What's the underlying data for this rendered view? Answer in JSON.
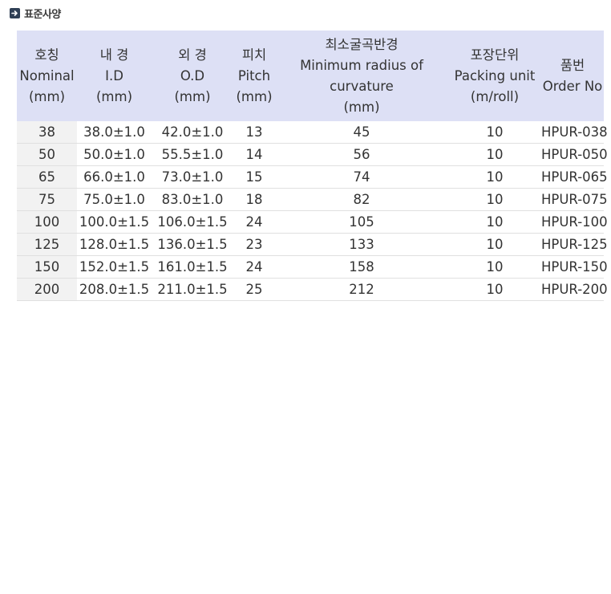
{
  "section": {
    "title": "표준사양",
    "icon": "arrow-right-icon"
  },
  "table": {
    "headers": [
      {
        "lines": [
          "호칭",
          "Nominal",
          "(mm)"
        ]
      },
      {
        "lines": [
          "내 경",
          "I.D",
          "(mm)"
        ]
      },
      {
        "lines": [
          "외 경",
          "O.D",
          "(mm)"
        ]
      },
      {
        "lines": [
          "피치",
          "Pitch",
          "(mm)"
        ]
      },
      {
        "lines": [
          "최소굴곡반경",
          "Minimum radius of",
          "curvature",
          "(mm)"
        ]
      },
      {
        "lines": [
          "포장단위",
          "Packing unit",
          "(m/roll)"
        ]
      },
      {
        "lines": [
          "품번",
          "Order No"
        ]
      }
    ],
    "rows": [
      [
        "38",
        "38.0±1.0",
        "42.0±1.0",
        "13",
        "45",
        "10",
        "HPUR-038"
      ],
      [
        "50",
        "50.0±1.0",
        "55.5±1.0",
        "14",
        "56",
        "10",
        "HPUR-050"
      ],
      [
        "65",
        "66.0±1.0",
        "73.0±1.0",
        "15",
        "74",
        "10",
        "HPUR-065"
      ],
      [
        "75",
        "75.0±1.0",
        "83.0±1.0",
        "18",
        "82",
        "10",
        "HPUR-075"
      ],
      [
        "100",
        "100.0±1.5",
        "106.0±1.5",
        "24",
        "105",
        "10",
        "HPUR-100"
      ],
      [
        "125",
        "128.0±1.5",
        "136.0±1.5",
        "23",
        "133",
        "10",
        "HPUR-125"
      ],
      [
        "150",
        "152.0±1.5",
        "161.0±1.5",
        "24",
        "158",
        "10",
        "HPUR-150"
      ],
      [
        "200",
        "208.0±1.5",
        "211.0±1.5",
        "25",
        "212",
        "10",
        "HPUR-200"
      ]
    ]
  },
  "colors": {
    "header_bg": "#dde0f5",
    "nominal_col_bg": "#f2f2f2",
    "icon_bg": "#2f3f55"
  }
}
